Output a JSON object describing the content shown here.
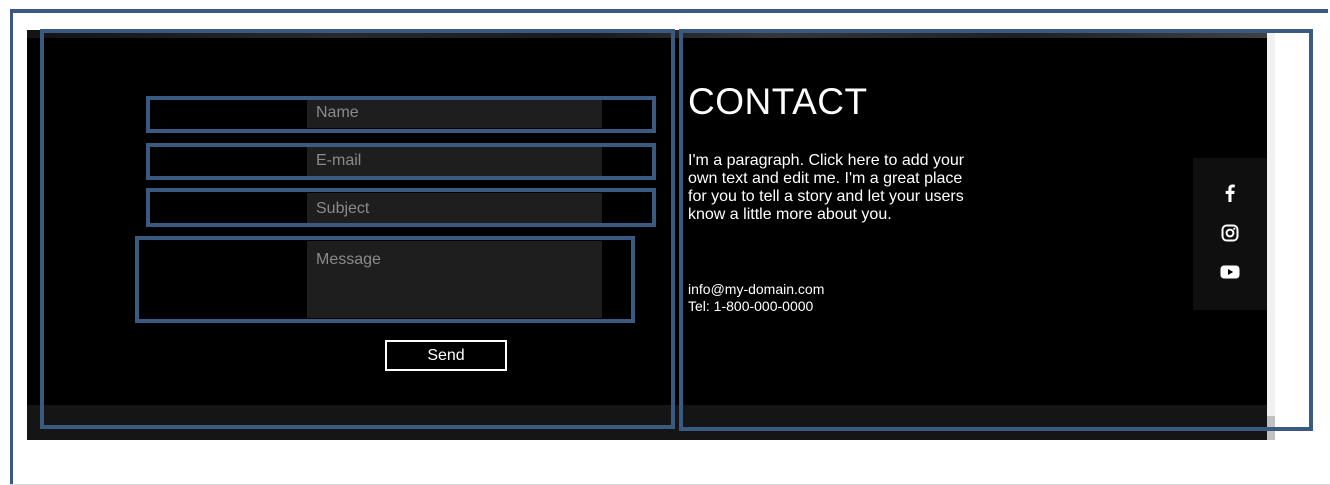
{
  "form": {
    "name_placeholder": "Name",
    "email_placeholder": "E-mail",
    "subject_placeholder": "Subject",
    "message_placeholder": "Message",
    "send_label": "Send"
  },
  "contact": {
    "title": "CONTACT",
    "paragraph": "I'm a paragraph. Click here to add your own text and edit me. I'm a great place for you to tell a story and let your users know a little more about you.",
    "email": "info@my-domain.com",
    "tel": "Tel: 1-800-000-0000"
  },
  "social": {
    "icons": [
      "facebook-icon",
      "instagram-icon",
      "youtube-icon"
    ]
  },
  "colors": {
    "section_background": "#000000",
    "field_background": "#1e1e1e",
    "annotation_border": "#3b5a82",
    "text": "#ffffff",
    "placeholder_text": "#8a8a8a"
  }
}
